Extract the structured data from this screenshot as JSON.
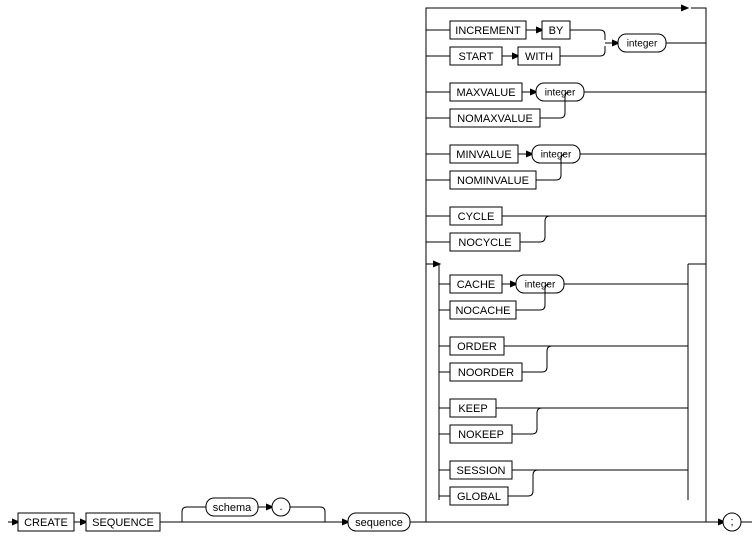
{
  "chart_data": {
    "type": "syntax-diagram",
    "title": "CREATE SEQUENCE",
    "main_path": [
      "CREATE",
      "SEQUENCE",
      "schema",
      ".",
      "sequence",
      ";"
    ],
    "option_groups": [
      {
        "alternatives": [
          {
            "tokens": [
              "INCREMENT",
              "BY"
            ],
            "trailing_arg": "integer"
          },
          {
            "tokens": [
              "START",
              "WITH"
            ],
            "trailing_arg": "integer"
          }
        ]
      },
      {
        "alternatives": [
          {
            "tokens": [
              "MAXVALUE"
            ],
            "trailing_arg": "integer"
          },
          {
            "tokens": [
              "NOMAXVALUE"
            ]
          }
        ]
      },
      {
        "alternatives": [
          {
            "tokens": [
              "MINVALUE"
            ],
            "trailing_arg": "integer"
          },
          {
            "tokens": [
              "NOMINVALUE"
            ]
          }
        ]
      },
      {
        "alternatives": [
          {
            "tokens": [
              "CYCLE"
            ]
          },
          {
            "tokens": [
              "NOCYCLE"
            ]
          }
        ]
      },
      {
        "alternatives": [
          {
            "tokens": [
              "CACHE"
            ],
            "trailing_arg": "integer"
          },
          {
            "tokens": [
              "NOCACHE"
            ]
          }
        ]
      },
      {
        "alternatives": [
          {
            "tokens": [
              "ORDER"
            ]
          },
          {
            "tokens": [
              "NOORDER"
            ]
          }
        ]
      },
      {
        "alternatives": [
          {
            "tokens": [
              "KEEP"
            ]
          },
          {
            "tokens": [
              "NOKEEP"
            ]
          }
        ]
      },
      {
        "alternatives": [
          {
            "tokens": [
              "SESSION"
            ]
          },
          {
            "tokens": [
              "GLOBAL"
            ]
          }
        ]
      }
    ]
  },
  "labels": {
    "create": "CREATE",
    "sequence_kw": "SEQUENCE",
    "schema": "schema",
    "dot": ".",
    "sequence": "sequence",
    "semicolon": ";",
    "increment": "INCREMENT",
    "by": "BY",
    "start": "START",
    "with": "WITH",
    "integer": "integer",
    "maxvalue": "MAXVALUE",
    "nomaxvalue": "NOMAXVALUE",
    "minvalue": "MINVALUE",
    "nominvalue": "NOMINVALUE",
    "cycle": "CYCLE",
    "nocycle": "NOCYCLE",
    "cache": "CACHE",
    "nocache": "NOCACHE",
    "order": "ORDER",
    "noorder": "NOORDER",
    "keep": "KEEP",
    "nokeep": "NOKEEP",
    "session": "SESSION",
    "global": "GLOBAL"
  }
}
